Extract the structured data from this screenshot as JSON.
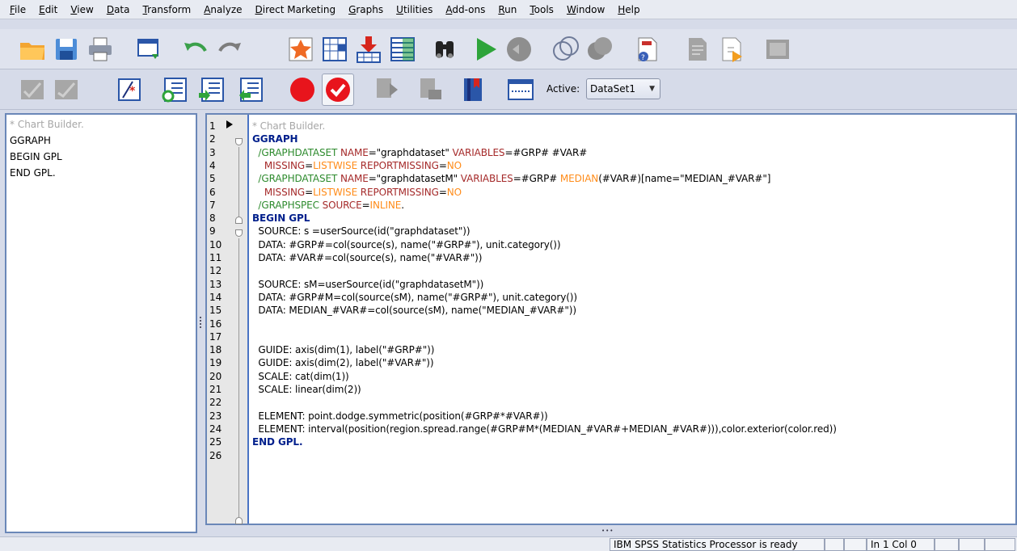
{
  "menu": [
    "File",
    "Edit",
    "View",
    "Data",
    "Transform",
    "Analyze",
    "Direct Marketing",
    "Graphs",
    "Utilities",
    "Add-ons",
    "Run",
    "Tools",
    "Window",
    "Help"
  ],
  "toolbar": {
    "active_label": "Active:",
    "active_dataset": "DataSet1"
  },
  "outline": [
    "* Chart Builder.",
    "GGRAPH",
    "BEGIN GPL",
    "END GPL."
  ],
  "editor": {
    "line_numbers": [
      "1",
      "2",
      "3",
      "4",
      "5",
      "6",
      "7",
      "8",
      "9",
      "10",
      "11",
      "12",
      "13",
      "14",
      "15",
      "16",
      "17",
      "18",
      "19",
      "20",
      "21",
      "22",
      "23",
      "24",
      "25",
      "26"
    ],
    "lines": [
      [
        [
          "c-com",
          "* Chart Builder."
        ]
      ],
      [
        [
          "c-kw",
          "GGRAPH"
        ]
      ],
      [
        [
          "c-sub",
          "  /GRAPHDATASET "
        ],
        [
          "c-kwd",
          "NAME"
        ],
        [
          "c-txt",
          "=\"graphdataset\" "
        ],
        [
          "c-kwd",
          "VARIABLES"
        ],
        [
          "c-txt",
          "=#GRP# #VAR#"
        ]
      ],
      [
        [
          "c-kwd",
          "    MISSING"
        ],
        [
          "c-txt",
          "="
        ],
        [
          "c-val",
          "LISTWISE "
        ],
        [
          "c-kwd",
          "REPORTMISSING"
        ],
        [
          "c-txt",
          "="
        ],
        [
          "c-val",
          "NO"
        ]
      ],
      [
        [
          "c-sub",
          "  /GRAPHDATASET "
        ],
        [
          "c-kwd",
          "NAME"
        ],
        [
          "c-txt",
          "=\"graphdatasetM\" "
        ],
        [
          "c-kwd",
          "VARIABLES"
        ],
        [
          "c-txt",
          "=#GRP# "
        ],
        [
          "c-val",
          "MEDIAN"
        ],
        [
          "c-txt",
          "(#VAR#)[name=\"MEDIAN_#VAR#\"]"
        ]
      ],
      [
        [
          "c-kwd",
          "    MISSING"
        ],
        [
          "c-txt",
          "="
        ],
        [
          "c-val",
          "LISTWISE "
        ],
        [
          "c-kwd",
          "REPORTMISSING"
        ],
        [
          "c-txt",
          "="
        ],
        [
          "c-val",
          "NO"
        ]
      ],
      [
        [
          "c-sub",
          "  /GRAPHSPEC "
        ],
        [
          "c-kwd",
          "SOURCE"
        ],
        [
          "c-txt",
          "="
        ],
        [
          "c-val",
          "INLINE"
        ],
        [
          "c-txt",
          "."
        ]
      ],
      [
        [
          "c-kw",
          "BEGIN GPL"
        ]
      ],
      [
        [
          "c-txt",
          "  SOURCE: s =userSource(id(\"graphdataset\"))"
        ]
      ],
      [
        [
          "c-txt",
          "  DATA: #GRP#=col(source(s), name(\"#GRP#\"), unit.category())"
        ]
      ],
      [
        [
          "c-txt",
          "  DATA: #VAR#=col(source(s), name(\"#VAR#\"))"
        ]
      ],
      [
        [
          "c-txt",
          ""
        ]
      ],
      [
        [
          "c-txt",
          "  SOURCE: sM=userSource(id(\"graphdatasetM\"))"
        ]
      ],
      [
        [
          "c-txt",
          "  DATA: #GRP#M=col(source(sM), name(\"#GRP#\"), unit.category())"
        ]
      ],
      [
        [
          "c-txt",
          "  DATA: MEDIAN_#VAR#=col(source(sM), name(\"MEDIAN_#VAR#\"))"
        ]
      ],
      [
        [
          "c-txt",
          ""
        ]
      ],
      [
        [
          "c-txt",
          ""
        ]
      ],
      [
        [
          "c-txt",
          "  GUIDE: axis(dim(1), label(\"#GRP#\"))"
        ]
      ],
      [
        [
          "c-txt",
          "  GUIDE: axis(dim(2), label(\"#VAR#\"))"
        ]
      ],
      [
        [
          "c-txt",
          "  SCALE: cat(dim(1))"
        ]
      ],
      [
        [
          "c-txt",
          "  SCALE: linear(dim(2))"
        ]
      ],
      [
        [
          "c-txt",
          ""
        ]
      ],
      [
        [
          "c-txt",
          "  ELEMENT: point.dodge.symmetric(position(#GRP#*#VAR#))"
        ]
      ],
      [
        [
          "c-txt",
          "  ELEMENT: interval(position(region.spread.range(#GRP#M*(MEDIAN_#VAR#+MEDIAN_#VAR#))),color.exterior(color.red))"
        ]
      ],
      [
        [
          "c-kw",
          "END GPL."
        ]
      ],
      [
        [
          "c-txt",
          ""
        ]
      ]
    ]
  },
  "status": {
    "processor": "IBM SPSS Statistics Processor is ready",
    "position": "In 1 Col 0"
  },
  "icons": [
    "open-folder-icon",
    "save-icon",
    "print-icon",
    "dialog-recall-icon",
    "undo-icon",
    "redo-icon",
    "chart-builder-icon",
    "goto-case-icon",
    "insert-variable-icon",
    "variables-icon",
    "find-icon",
    "run-icon",
    "stop-icon",
    "venn-icon",
    "split-icon",
    "script-icon",
    "syntax-icon",
    "output-icon",
    "window-icon",
    "check-syntax-icon",
    "validate-icon",
    "comment-icon",
    "step-into-icon",
    "step-over-icon",
    "step-out-icon",
    "breakpoint-icon",
    "bookmark-check-icon",
    "toggle-icon",
    "doc-icon",
    "bookmark-icon",
    "line-icon"
  ],
  "colors": {
    "keyword": "#001f8c",
    "subcommand": "#2e8b2e",
    "keyword2": "#a52a2a",
    "value": "#ff8c1a",
    "comment": "#a6a6a6"
  }
}
